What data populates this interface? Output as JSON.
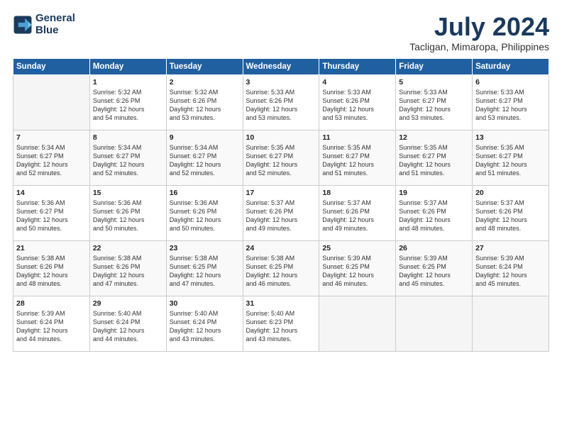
{
  "logo": {
    "line1": "General",
    "line2": "Blue"
  },
  "title": "July 2024",
  "subtitle": "Tacligan, Mimaropa, Philippines",
  "days_header": [
    "Sunday",
    "Monday",
    "Tuesday",
    "Wednesday",
    "Thursday",
    "Friday",
    "Saturday"
  ],
  "weeks": [
    [
      {
        "num": "",
        "content": ""
      },
      {
        "num": "1",
        "content": "Sunrise: 5:32 AM\nSunset: 6:26 PM\nDaylight: 12 hours\nand 54 minutes."
      },
      {
        "num": "2",
        "content": "Sunrise: 5:32 AM\nSunset: 6:26 PM\nDaylight: 12 hours\nand 53 minutes."
      },
      {
        "num": "3",
        "content": "Sunrise: 5:33 AM\nSunset: 6:26 PM\nDaylight: 12 hours\nand 53 minutes."
      },
      {
        "num": "4",
        "content": "Sunrise: 5:33 AM\nSunset: 6:26 PM\nDaylight: 12 hours\nand 53 minutes."
      },
      {
        "num": "5",
        "content": "Sunrise: 5:33 AM\nSunset: 6:27 PM\nDaylight: 12 hours\nand 53 minutes."
      },
      {
        "num": "6",
        "content": "Sunrise: 5:33 AM\nSunset: 6:27 PM\nDaylight: 12 hours\nand 53 minutes."
      }
    ],
    [
      {
        "num": "7",
        "content": "Sunrise: 5:34 AM\nSunset: 6:27 PM\nDaylight: 12 hours\nand 52 minutes."
      },
      {
        "num": "8",
        "content": "Sunrise: 5:34 AM\nSunset: 6:27 PM\nDaylight: 12 hours\nand 52 minutes."
      },
      {
        "num": "9",
        "content": "Sunrise: 5:34 AM\nSunset: 6:27 PM\nDaylight: 12 hours\nand 52 minutes."
      },
      {
        "num": "10",
        "content": "Sunrise: 5:35 AM\nSunset: 6:27 PM\nDaylight: 12 hours\nand 52 minutes."
      },
      {
        "num": "11",
        "content": "Sunrise: 5:35 AM\nSunset: 6:27 PM\nDaylight: 12 hours\nand 51 minutes."
      },
      {
        "num": "12",
        "content": "Sunrise: 5:35 AM\nSunset: 6:27 PM\nDaylight: 12 hours\nand 51 minutes."
      },
      {
        "num": "13",
        "content": "Sunrise: 5:35 AM\nSunset: 6:27 PM\nDaylight: 12 hours\nand 51 minutes."
      }
    ],
    [
      {
        "num": "14",
        "content": "Sunrise: 5:36 AM\nSunset: 6:27 PM\nDaylight: 12 hours\nand 50 minutes."
      },
      {
        "num": "15",
        "content": "Sunrise: 5:36 AM\nSunset: 6:26 PM\nDaylight: 12 hours\nand 50 minutes."
      },
      {
        "num": "16",
        "content": "Sunrise: 5:36 AM\nSunset: 6:26 PM\nDaylight: 12 hours\nand 50 minutes."
      },
      {
        "num": "17",
        "content": "Sunrise: 5:37 AM\nSunset: 6:26 PM\nDaylight: 12 hours\nand 49 minutes."
      },
      {
        "num": "18",
        "content": "Sunrise: 5:37 AM\nSunset: 6:26 PM\nDaylight: 12 hours\nand 49 minutes."
      },
      {
        "num": "19",
        "content": "Sunrise: 5:37 AM\nSunset: 6:26 PM\nDaylight: 12 hours\nand 48 minutes."
      },
      {
        "num": "20",
        "content": "Sunrise: 5:37 AM\nSunset: 6:26 PM\nDaylight: 12 hours\nand 48 minutes."
      }
    ],
    [
      {
        "num": "21",
        "content": "Sunrise: 5:38 AM\nSunset: 6:26 PM\nDaylight: 12 hours\nand 48 minutes."
      },
      {
        "num": "22",
        "content": "Sunrise: 5:38 AM\nSunset: 6:26 PM\nDaylight: 12 hours\nand 47 minutes."
      },
      {
        "num": "23",
        "content": "Sunrise: 5:38 AM\nSunset: 6:25 PM\nDaylight: 12 hours\nand 47 minutes."
      },
      {
        "num": "24",
        "content": "Sunrise: 5:38 AM\nSunset: 6:25 PM\nDaylight: 12 hours\nand 46 minutes."
      },
      {
        "num": "25",
        "content": "Sunrise: 5:39 AM\nSunset: 6:25 PM\nDaylight: 12 hours\nand 46 minutes."
      },
      {
        "num": "26",
        "content": "Sunrise: 5:39 AM\nSunset: 6:25 PM\nDaylight: 12 hours\nand 45 minutes."
      },
      {
        "num": "27",
        "content": "Sunrise: 5:39 AM\nSunset: 6:24 PM\nDaylight: 12 hours\nand 45 minutes."
      }
    ],
    [
      {
        "num": "28",
        "content": "Sunrise: 5:39 AM\nSunset: 6:24 PM\nDaylight: 12 hours\nand 44 minutes."
      },
      {
        "num": "29",
        "content": "Sunrise: 5:40 AM\nSunset: 6:24 PM\nDaylight: 12 hours\nand 44 minutes."
      },
      {
        "num": "30",
        "content": "Sunrise: 5:40 AM\nSunset: 6:24 PM\nDaylight: 12 hours\nand 43 minutes."
      },
      {
        "num": "31",
        "content": "Sunrise: 5:40 AM\nSunset: 6:23 PM\nDaylight: 12 hours\nand 43 minutes."
      },
      {
        "num": "",
        "content": ""
      },
      {
        "num": "",
        "content": ""
      },
      {
        "num": "",
        "content": ""
      }
    ]
  ]
}
